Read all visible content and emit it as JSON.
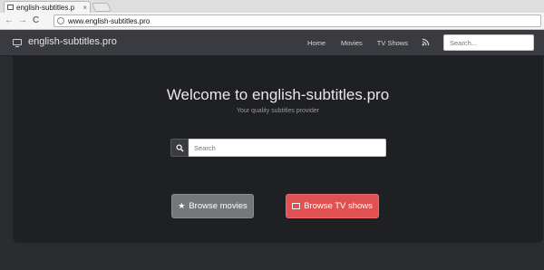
{
  "browser": {
    "tab_title": "english-subtitles.p",
    "tab_close": "×",
    "url": "www.english-subtitles.pro",
    "back": "←",
    "forward": "→",
    "reload": "C"
  },
  "navbar": {
    "brand": "english-subtitles.pro",
    "links": [
      "Home",
      "Movies",
      "TV Shows"
    ],
    "rss_icon": "rss-icon",
    "search_placeholder": "Search..."
  },
  "hero": {
    "title": "Welcome to english-subtitles.pro",
    "subtitle": "Your quality subtitles provider",
    "search_placeholder": "Search",
    "browse_movies": "Browse movies",
    "browse_tv": "Browse TV shows"
  },
  "colors": {
    "navbar_bg": "#3a3b40",
    "hero_bg": "#1f2024",
    "page_bg": "#2b2c30",
    "movies_button": "#75777b",
    "tv_button": "#e25152"
  }
}
